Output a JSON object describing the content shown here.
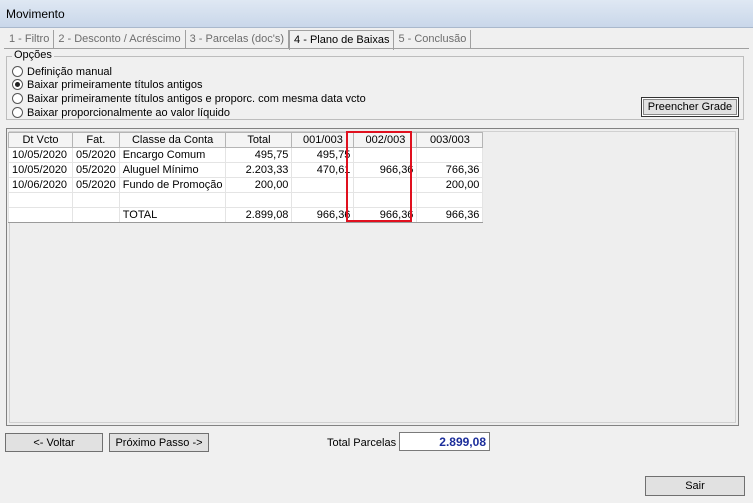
{
  "window": {
    "title": "Movimento"
  },
  "tabs": [
    {
      "label": "1 - Filtro"
    },
    {
      "label": "2 - Desconto / Acréscimo"
    },
    {
      "label": "3 - Parcelas (doc's)"
    },
    {
      "label": "4 - Plano de Baixas"
    },
    {
      "label": "5 - Conclusão"
    }
  ],
  "options": {
    "legend": "Opções",
    "items": [
      {
        "label": "Definição manual",
        "selected": false
      },
      {
        "label": "Baixar primeiramente títulos antigos",
        "selected": true
      },
      {
        "label": "Baixar primeiramente títulos antigos e proporc. com mesma data vcto",
        "selected": false
      },
      {
        "label": "Baixar proporcionalmente ao valor líquido",
        "selected": false
      }
    ],
    "fill_button": "Preencher Grade"
  },
  "grid": {
    "headers": [
      "Dt Vcto",
      "Fat.",
      "Classe da Conta",
      "Total",
      "001/003",
      "002/003",
      "003/003"
    ],
    "rows": [
      [
        "10/05/2020",
        "05/2020",
        "Encargo Comum",
        "495,75",
        "495,75",
        "",
        ""
      ],
      [
        "10/05/2020",
        "05/2020",
        "Aluguel Mínimo",
        "2.203,33",
        "470,61",
        "966,36",
        "766,36"
      ],
      [
        "10/06/2020",
        "05/2020",
        "Fundo de Promoção",
        "200,00",
        "",
        "",
        "200,00"
      ],
      [
        "",
        "",
        "",
        "",
        "",
        "",
        ""
      ],
      [
        "",
        "",
        "TOTAL",
        "2.899,08",
        "966,36",
        "966,36",
        "966,36"
      ]
    ]
  },
  "footer": {
    "back_button": "<- Voltar",
    "next_button": "Próximo Passo ->",
    "total_label": "Total Parcelas",
    "total_value": "2.899,08",
    "exit_button": "Sair"
  }
}
